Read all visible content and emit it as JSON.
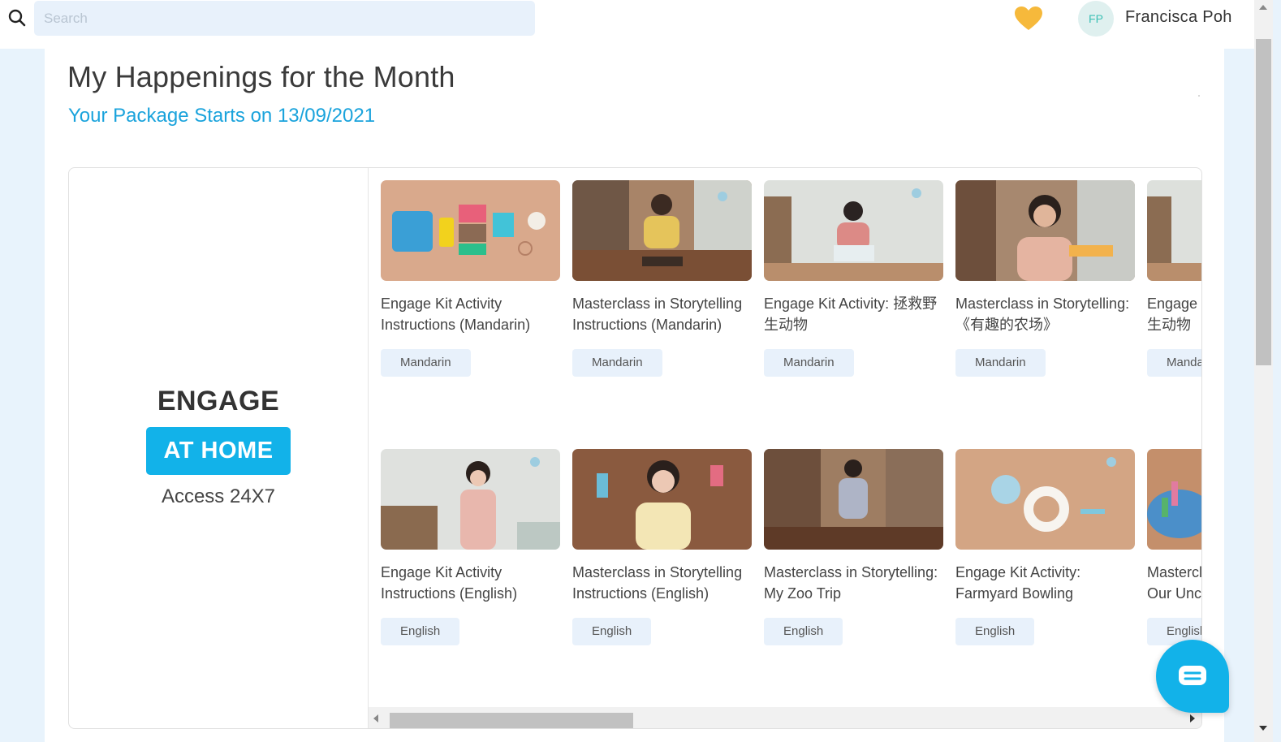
{
  "header": {
    "search_placeholder": "Search",
    "user_initials": "FP",
    "user_name": "Francisca Poh",
    "heart_color": "#f6b93b"
  },
  "main": {
    "title": "My Happenings for the Month",
    "subtitle": "Your Package Starts on 13/09/2021"
  },
  "left_panel": {
    "title": "ENGAGE",
    "badge": "AT HOME",
    "access": "Access 24X7"
  },
  "videos": {
    "row1": [
      {
        "title": "Engage Kit Activity Instructions (Mandarin)",
        "tag": "Mandarin"
      },
      {
        "title": "Masterclass in Storytelling Instructions (Mandarin)",
        "tag": "Mandarin"
      },
      {
        "title": "Engage Kit Activity: 拯救野生动物",
        "tag": "Mandarin"
      },
      {
        "title": "Masterclass in Storytelling: 《有趣的农场》",
        "tag": "Mandarin"
      },
      {
        "title": "Engage Kit Activity: 拯救野生动物",
        "tag": "Mandarin"
      }
    ],
    "row2": [
      {
        "title": "Engage Kit Activity Instructions (English)",
        "tag": "English"
      },
      {
        "title": "Masterclass in Storytelling Instructions (English)",
        "tag": "English"
      },
      {
        "title": "Masterclass in Storytelling: My Zoo Trip",
        "tag": "English"
      },
      {
        "title": "Engage Kit Activity: Farmyard Bowling",
        "tag": "English"
      },
      {
        "title": "Masterclass in Storytelling: Our Uncle",
        "tag": "English"
      }
    ]
  },
  "colors": {
    "accent": "#12b2e9",
    "subtitle": "#1aa3dc",
    "tag_bg": "#e8f1fb"
  }
}
